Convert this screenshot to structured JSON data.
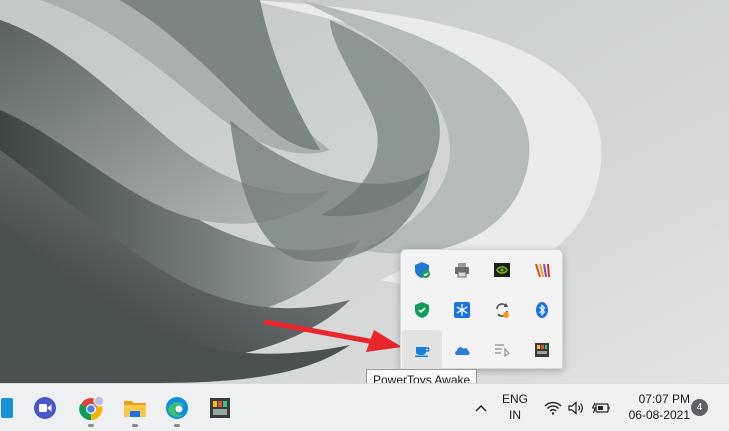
{
  "tooltip": {
    "text": "PowerToys Awake"
  },
  "tray_icons": [
    {
      "name": "windows-security-icon",
      "color": "#1f7ad6"
    },
    {
      "name": "printer-icon",
      "color": "#6b6b6b"
    },
    {
      "name": "nvidia-icon",
      "color": "#76b900"
    },
    {
      "name": "stripes-app-icon",
      "color": "#d24b2a"
    },
    {
      "name": "shield-check-icon",
      "color": "#0f9d58"
    },
    {
      "name": "snowflake-icon",
      "color": "#1a73e8"
    },
    {
      "name": "sync-icon",
      "color": "#f39c12"
    },
    {
      "name": "bluetooth-icon",
      "color": "#1a73e8"
    },
    {
      "name": "powertoys-awake-coffee-icon",
      "color": "#1480d8"
    },
    {
      "name": "onedrive-cloud-icon",
      "color": "#2b7cd3"
    },
    {
      "name": "media-list-icon",
      "color": "#9a9a9a"
    },
    {
      "name": "app-grid-icon",
      "color": "#3a3a3a"
    }
  ],
  "taskbar": {
    "apps": [
      {
        "name": "task-view-icon"
      },
      {
        "name": "zoom-video-icon"
      },
      {
        "name": "chrome-icon"
      },
      {
        "name": "file-explorer-icon"
      },
      {
        "name": "edge-icon"
      },
      {
        "name": "app-tile-icon"
      }
    ],
    "language": {
      "line1": "ENG",
      "line2": "IN"
    },
    "clock": {
      "time": "07:07 PM",
      "date": "06-08-2021"
    },
    "notification_count": "4"
  },
  "colors": {
    "arrow": "#e8262b",
    "taskbar": "#eef0f2"
  }
}
